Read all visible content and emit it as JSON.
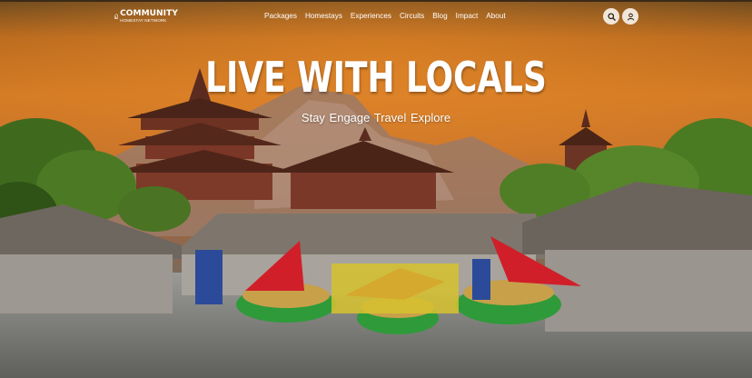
{
  "brand": {
    "name": "COMMUNITY",
    "subtitle": "HOMESTAY NETWORK"
  },
  "nav": {
    "items": [
      "Packages",
      "Homestays",
      "Experiences",
      "Circuits",
      "Blog",
      "Impact",
      "About"
    ]
  },
  "icons": {
    "search": "search-icon",
    "user": "user-icon"
  },
  "hero": {
    "headline": "LIVE WITH LOCALS",
    "tagline": "Stay Engage Travel Explore"
  },
  "colors": {
    "sky_top": "#6d4a1f",
    "sky_mid": "#d27a25",
    "button_bg": "#f1e6d8",
    "text": "#ffffff"
  }
}
